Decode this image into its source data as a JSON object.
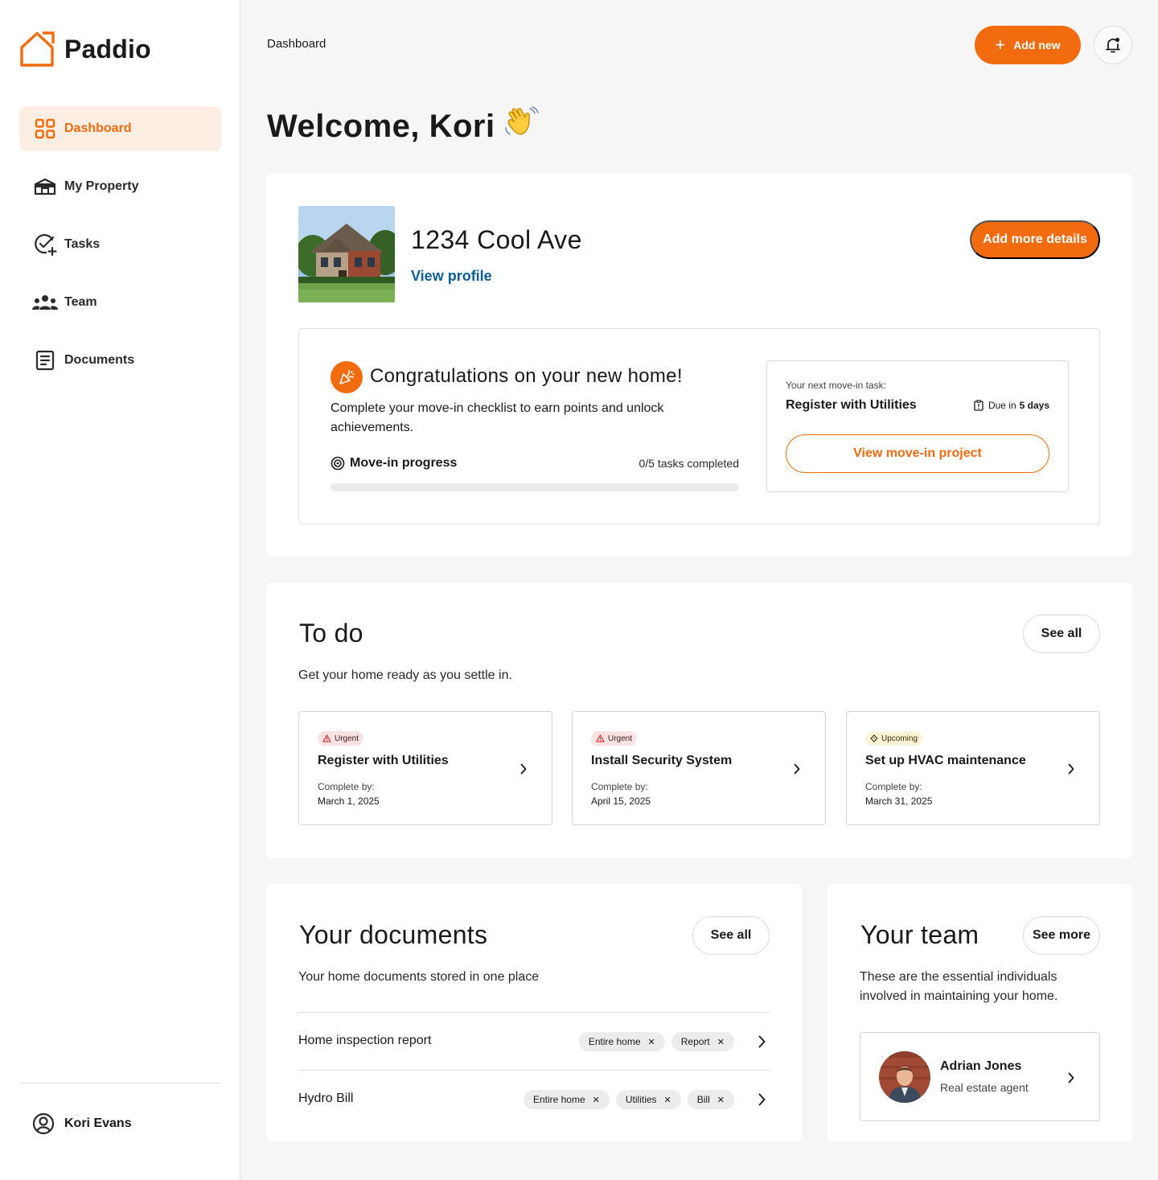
{
  "app": {
    "name": "Paddio"
  },
  "sidebar": {
    "items": [
      {
        "label": "Dashboard",
        "icon": "grid-icon",
        "active": true
      },
      {
        "label": "My Property",
        "icon": "house-icon"
      },
      {
        "label": "Tasks",
        "icon": "check-circle-icon"
      },
      {
        "label": "Team",
        "icon": "people-icon"
      },
      {
        "label": "Documents",
        "icon": "document-icon"
      }
    ],
    "user": "Kori Evans"
  },
  "header": {
    "breadcrumb": "Dashboard",
    "add_new_label": "Add new",
    "welcome": "Welcome, Kori"
  },
  "property": {
    "address": "1234 Cool Ave",
    "view_profile": "View profile",
    "add_details_label": "Add more details",
    "congrats": {
      "title": "Congratulations on your new home!",
      "text": "Complete your move-in checklist to earn points and unlock achievements.",
      "progress_label": "Move-in progress",
      "progress_count": "0/5 tasks completed",
      "progress_fraction": 0
    },
    "next_task": {
      "caption": "Your next move-in task:",
      "title": "Register with Utilities",
      "due_prefix": "Due in",
      "due_value": "5 days",
      "button": "View move-in project"
    }
  },
  "todo": {
    "title": "To do",
    "subtitle": "Get your home ready as you settle in.",
    "see_all": "See all",
    "tasks": [
      {
        "badge": "Urgent",
        "title": "Register with Utilities",
        "caption": "Complete by:",
        "date": "March 1, 2025"
      },
      {
        "badge": "Urgent",
        "title": "Install Security System",
        "caption": "Complete by:",
        "date": "April 15, 2025"
      },
      {
        "badge": "Upcoming",
        "title": "Set up HVAC maintenance",
        "caption": "Complete by:",
        "date": "March 31, 2025"
      }
    ]
  },
  "documents": {
    "title": "Your documents",
    "subtitle": "Your home documents stored in one place",
    "see_all": "See all",
    "items": [
      {
        "name": "Home inspection report",
        "tags": [
          "Entire home",
          "Report"
        ]
      },
      {
        "name": "Hydro Bill",
        "tags": [
          "Entire home",
          "Utilities",
          "Bill"
        ]
      }
    ]
  },
  "team": {
    "title": "Your team",
    "subtitle": "These are the essential individuals involved in maintaining your home.",
    "see_more": "See more",
    "members": [
      {
        "name": "Adrian Jones",
        "role": "Real estate agent"
      }
    ]
  },
  "colors": {
    "accent": "#f26b0f",
    "link": "#0b5d99",
    "accent_soft": "#fdeee3"
  }
}
